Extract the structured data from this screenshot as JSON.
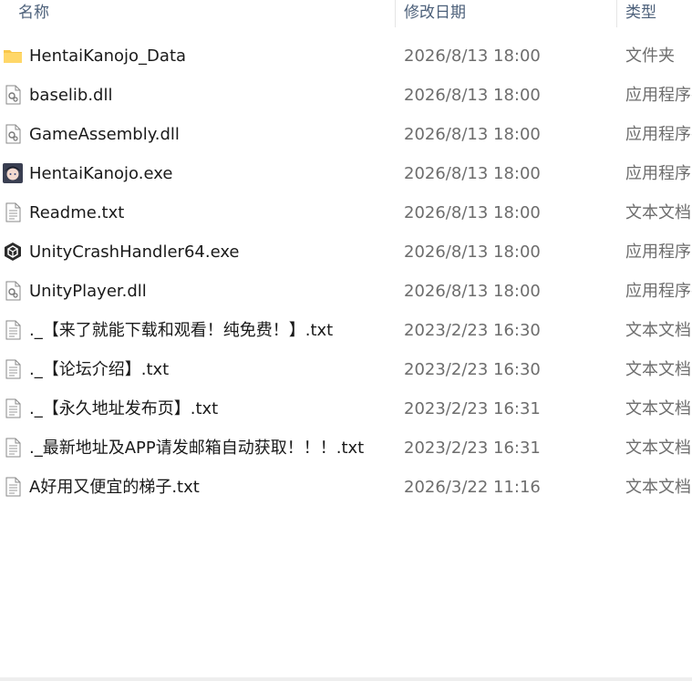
{
  "columns": {
    "name": "名称",
    "date": "修改日期",
    "type": "类型"
  },
  "files": [
    {
      "name": "HentaiKanojo_Data",
      "date": "2026/8/13 18:00",
      "type": "文件夹",
      "icon": "folder-icon"
    },
    {
      "name": "baselib.dll",
      "date": "2026/8/13 18:00",
      "type": "应用程序扩展",
      "icon": "dll-file-icon"
    },
    {
      "name": "GameAssembly.dll",
      "date": "2026/8/13 18:00",
      "type": "应用程序扩展",
      "icon": "dll-file-icon"
    },
    {
      "name": "HentaiKanojo.exe",
      "date": "2026/8/13 18:00",
      "type": "应用程序",
      "icon": "app-avatar-icon"
    },
    {
      "name": "Readme.txt",
      "date": "2026/8/13 18:00",
      "type": "文本文档",
      "icon": "text-file-icon"
    },
    {
      "name": "UnityCrashHandler64.exe",
      "date": "2026/8/13 18:00",
      "type": "应用程序",
      "icon": "unity-icon"
    },
    {
      "name": "UnityPlayer.dll",
      "date": "2026/8/13 18:00",
      "type": "应用程序扩展",
      "icon": "dll-file-icon"
    },
    {
      "name": "._【来了就能下载和观看！纯免费！】.txt",
      "date": "2023/2/23 16:30",
      "type": "文本文档",
      "icon": "text-file-icon"
    },
    {
      "name": "._【论坛介绍】.txt",
      "date": "2023/2/23 16:30",
      "type": "文本文档",
      "icon": "text-file-icon"
    },
    {
      "name": "._【永久地址发布页】.txt",
      "date": "2023/2/23 16:31",
      "type": "文本文档",
      "icon": "text-file-icon"
    },
    {
      "name": "._最新地址及APP请发邮箱自动获取！！！.txt",
      "date": "2023/2/23 16:31",
      "type": "文本文档",
      "icon": "text-file-icon"
    },
    {
      "name": "A好用又便宜的梯子.txt",
      "date": "2026/3/22 11:16",
      "type": "文本文档",
      "icon": "text-file-icon"
    }
  ]
}
